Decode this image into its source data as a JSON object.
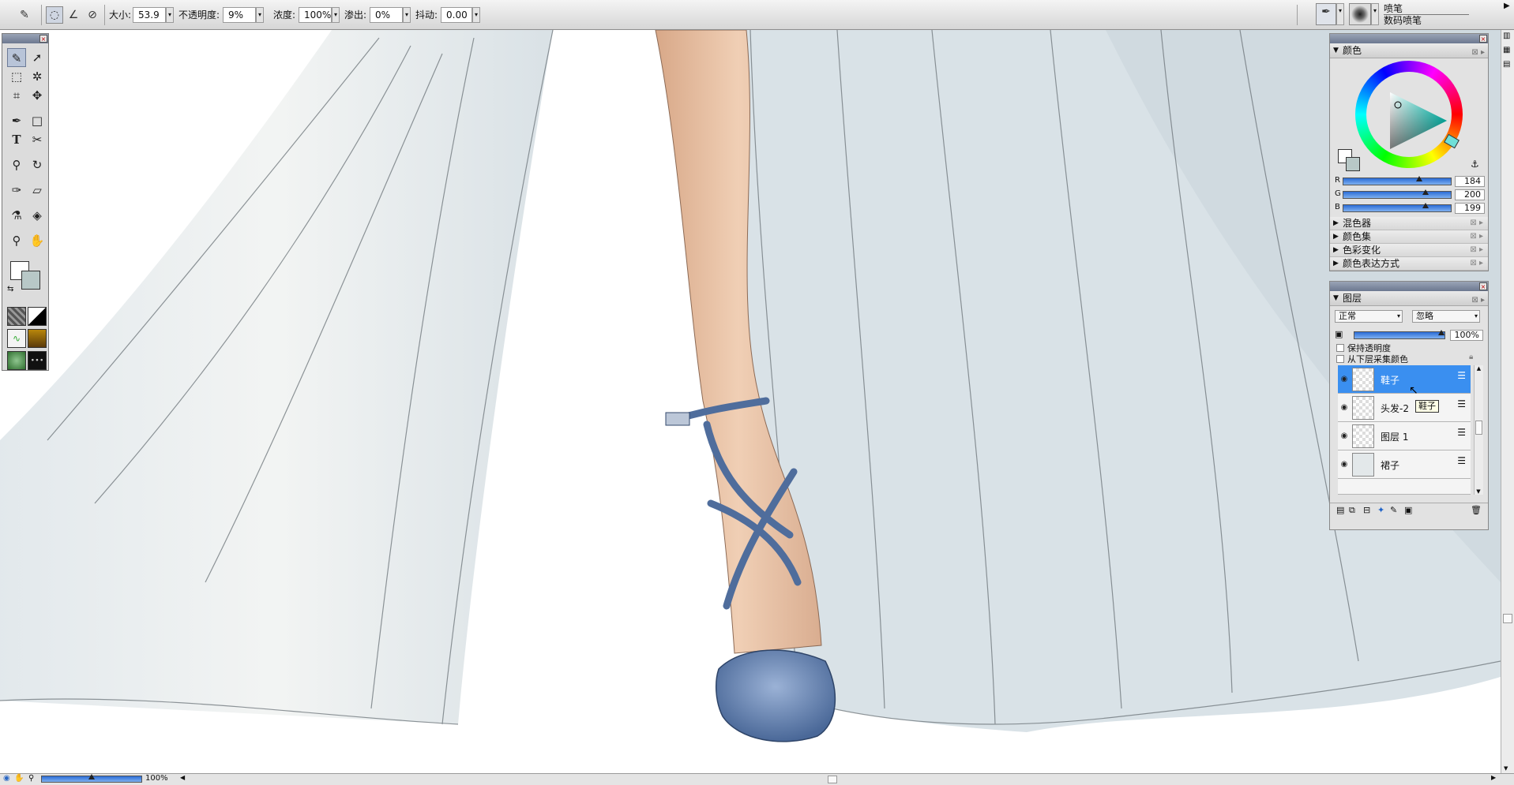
{
  "options_bar": {
    "size_label": "大小:",
    "size_value": "53.9",
    "opacity_label": "不透明度:",
    "opacity_value": "9%",
    "density_label": "浓度:",
    "density_value": "100%",
    "bleed_label": "渗出:",
    "bleed_value": "0%",
    "jitter_label": "抖动:",
    "jitter_value": "0.00"
  },
  "brush_selector": {
    "category": "喷笔",
    "variant": "数码喷笔"
  },
  "color_panel": {
    "title": "颜色",
    "r_label": "R",
    "g_label": "G",
    "b_label": "B",
    "r_value": "184",
    "g_value": "200",
    "b_value": "199",
    "r": 184,
    "g": 200,
    "b": 199,
    "collapsed_sections": [
      "混色器",
      "颜色集",
      "色彩变化",
      "颜色表达方式"
    ]
  },
  "layers_panel": {
    "title": "图层",
    "composite_method": "正常",
    "composite_depth": "忽略",
    "opacity_value": "100%",
    "opacity": 100,
    "preserve_transparency": "保持透明度",
    "pick_up_color": "从下层采集颜色",
    "layers": [
      {
        "name": "鞋子",
        "selected": true
      },
      {
        "name": "头发-2",
        "selected": false
      },
      {
        "name": "图层 1",
        "selected": false
      },
      {
        "name": "裙子",
        "selected": false
      }
    ],
    "tooltip": "鞋子"
  },
  "status_bar": {
    "zoom_value": "100%",
    "zoom": 100
  },
  "colors": {
    "accent": "#3a8ff0",
    "shoe": "#5f7fb0",
    "skin": "#e8bfa0",
    "dress": "#e6ecee"
  }
}
